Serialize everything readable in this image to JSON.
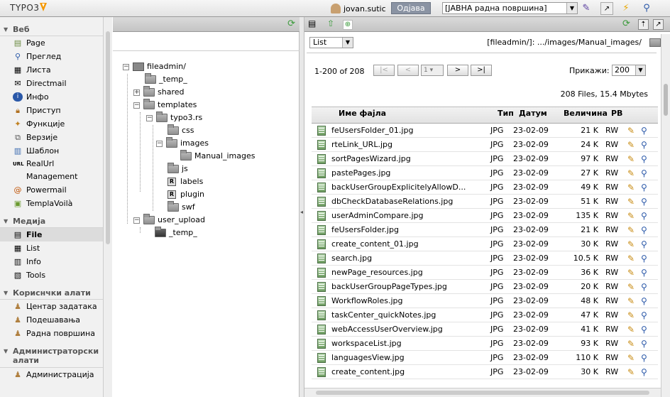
{
  "topbar": {
    "logo_text": "TYPO3",
    "username": "jovan.sutic",
    "logout_label": "Одјава",
    "workspace_value": "[ЈАВНА радна површина]"
  },
  "modules": {
    "groups": [
      {
        "label": "Веб",
        "items": [
          "Page",
          "Преглед",
          "Листа",
          "Directmail",
          "Инфо",
          "Приступ",
          "Функције",
          "Верзије",
          "Шаблон",
          "RealUrl Management",
          "Powermail",
          "TemplaVoilà"
        ]
      },
      {
        "label": "Медија",
        "items": [
          "File",
          "List",
          "Info",
          "Tools"
        ]
      },
      {
        "label": "Кориснчки алати",
        "items": [
          "Центар задатака",
          "Подешавања",
          "Радна површина"
        ]
      },
      {
        "label": "Администраторски алати",
        "items": [
          "Администрација"
        ]
      }
    ]
  },
  "tree": {
    "nodes": [
      "fileadmin/",
      "_temp_",
      "shared",
      "templates",
      "typo3.rs",
      "css",
      "images",
      "Manual_images",
      "js",
      "labels",
      "plugin",
      "swf",
      "user_upload",
      "_temp_"
    ]
  },
  "filelist": {
    "view_select": "List",
    "path": "[fileadmin/]: .../images/Manual_images/",
    "range": "1-200 of 208",
    "page_select": "1",
    "show_label": "Прикажи:",
    "show_value": "200",
    "summary": "208 Files, 15.4 Mbytes",
    "headers": {
      "name": "Име фајла",
      "type": "Тип",
      "date": "Датум",
      "size": "Величина",
      "rw": "РВ"
    },
    "rows": [
      {
        "name": "feUsersFolder_01.jpg",
        "type": "JPG",
        "date": "23-02-09",
        "size": "21 K",
        "rw": "RW"
      },
      {
        "name": "rteLink_URL.jpg",
        "type": "JPG",
        "date": "23-02-09",
        "size": "24 K",
        "rw": "RW"
      },
      {
        "name": "sortPagesWizard.jpg",
        "type": "JPG",
        "date": "23-02-09",
        "size": "97 K",
        "rw": "RW"
      },
      {
        "name": "pastePages.jpg",
        "type": "JPG",
        "date": "23-02-09",
        "size": "27 K",
        "rw": "RW"
      },
      {
        "name": "backUserGroupExplicitelyAllowD...",
        "type": "JPG",
        "date": "23-02-09",
        "size": "49 K",
        "rw": "RW"
      },
      {
        "name": "dbCheckDatabaseRelations.jpg",
        "type": "JPG",
        "date": "23-02-09",
        "size": "51 K",
        "rw": "RW"
      },
      {
        "name": "userAdminCompare.jpg",
        "type": "JPG",
        "date": "23-02-09",
        "size": "135 K",
        "rw": "RW"
      },
      {
        "name": "feUsersFolder.jpg",
        "type": "JPG",
        "date": "23-02-09",
        "size": "21 K",
        "rw": "RW"
      },
      {
        "name": "create_content_01.jpg",
        "type": "JPG",
        "date": "23-02-09",
        "size": "30 K",
        "rw": "RW"
      },
      {
        "name": "search.jpg",
        "type": "JPG",
        "date": "23-02-09",
        "size": "10.5 K",
        "rw": "RW"
      },
      {
        "name": "newPage_resources.jpg",
        "type": "JPG",
        "date": "23-02-09",
        "size": "36 K",
        "rw": "RW"
      },
      {
        "name": "backUserGroupPageTypes.jpg",
        "type": "JPG",
        "date": "23-02-09",
        "size": "20 K",
        "rw": "RW"
      },
      {
        "name": "WorkflowRoles.jpg",
        "type": "JPG",
        "date": "23-02-09",
        "size": "48 K",
        "rw": "RW"
      },
      {
        "name": "taskCenter_quickNotes.jpg",
        "type": "JPG",
        "date": "23-02-09",
        "size": "47 K",
        "rw": "RW"
      },
      {
        "name": "webAccessUserOverview.jpg",
        "type": "JPG",
        "date": "23-02-09",
        "size": "41 K",
        "rw": "RW"
      },
      {
        "name": "workspaceList.jpg",
        "type": "JPG",
        "date": "23-02-09",
        "size": "93 K",
        "rw": "RW"
      },
      {
        "name": "languagesView.jpg",
        "type": "JPG",
        "date": "23-02-09",
        "size": "110 K",
        "rw": "RW"
      },
      {
        "name": "create_content.jpg",
        "type": "JPG",
        "date": "23-02-09",
        "size": "30 K",
        "rw": "RW"
      }
    ]
  }
}
